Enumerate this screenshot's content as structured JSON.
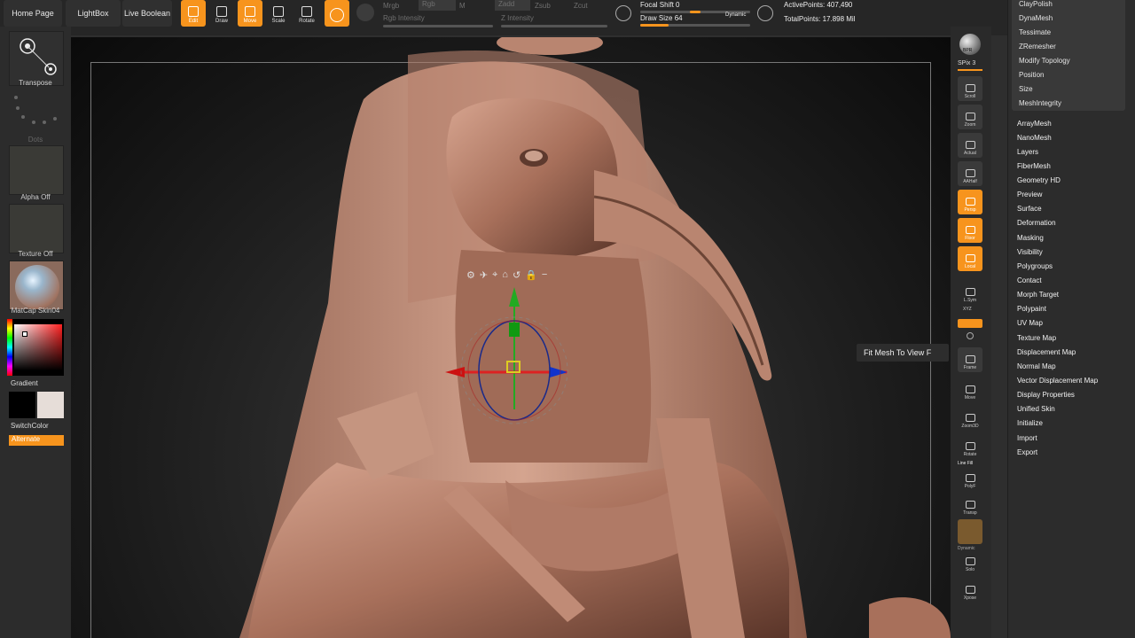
{
  "topbar": {
    "home_page": "Home Page",
    "lightbox": "LightBox",
    "live_boolean": "Live Boolean",
    "tools": [
      {
        "label": "Edit",
        "active": true
      },
      {
        "label": "Draw",
        "active": false
      },
      {
        "label": "Move",
        "active": true
      },
      {
        "label": "Scale",
        "active": false
      },
      {
        "label": "Rotate",
        "active": false
      }
    ],
    "mrgb": "Mrgb",
    "rgb": "Rgb",
    "m": "M",
    "zadd": "Zadd",
    "zsub": "Zsub",
    "zcut": "Zcut",
    "rgb_intensity": "Rgb Intensity",
    "z_intensity": "Z Intensity",
    "focal_shift_label": "Focal Shift",
    "focal_shift_value": "0",
    "draw_size_label": "Draw Size",
    "draw_size_value": "64",
    "dynamic": "Dynamic",
    "active_points": "ActivePoints: 407,490",
    "total_points": "TotalPoints: 17.898 Mil"
  },
  "leftpanel": {
    "transpose": "Transpose",
    "dots": "Dots",
    "alpha": "Alpha Off",
    "texture": "Texture Off",
    "matcap": "MatCap Skin04",
    "gradient": "Gradient",
    "switchcolor": "SwitchColor",
    "alternate": "Alternate",
    "main_color": "#000000",
    "secondary_color": "#e6ddd8"
  },
  "righttools": {
    "bpr": "BPR",
    "spix": "SPix 3",
    "items": [
      {
        "label": "Scroll",
        "active": false
      },
      {
        "label": "Zoom",
        "active": false
      },
      {
        "label": "Actual",
        "active": false
      },
      {
        "label": "AAHalf",
        "active": false
      },
      {
        "label": "Persp",
        "active": true
      },
      {
        "label": "Floor",
        "active": true
      },
      {
        "label": "Local",
        "active": true
      },
      {
        "label": "L.Sym",
        "active": false
      },
      {
        "label": "Frame",
        "active": false
      },
      {
        "label": "Move",
        "active": false
      },
      {
        "label": "Zoom3D",
        "active": false
      },
      {
        "label": "Rotate",
        "active": false
      },
      {
        "label": "PolyF",
        "active": false
      },
      {
        "label": "Transp",
        "active": false
      },
      {
        "label": "Solo",
        "active": false
      },
      {
        "label": "Xpose",
        "active": false
      }
    ],
    "xyz": "XYZ",
    "line_fill": "Line Fill",
    "dynamic": "Dynamic"
  },
  "tooltip": "Fit Mesh To View  F",
  "submenu": [
    "ClayPolish",
    "DynaMesh",
    "Tessimate",
    "ZRemesher",
    "Modify Topology",
    "Position",
    "Size",
    "MeshIntegrity"
  ],
  "menu": [
    "ArrayMesh",
    "NanoMesh",
    "Layers",
    "FiberMesh",
    "Geometry HD",
    "Preview",
    "Surface",
    "Deformation",
    "Masking",
    "Visibility",
    "Polygroups",
    "Contact",
    "Morph Target",
    "Polypaint",
    "UV Map",
    "Texture Map",
    "Displacement Map",
    "Normal Map",
    "Vector Displacement Map",
    "Display Properties",
    "Unified Skin",
    "Initialize",
    "Import",
    "Export"
  ],
  "colors": {
    "accent": "#f7941d",
    "sculpt": "#b98570"
  },
  "icons": [
    "transpose-icon",
    "gear-icon",
    "pin-icon",
    "home-icon",
    "undo-icon",
    "lock-icon",
    "minus-icon"
  ]
}
